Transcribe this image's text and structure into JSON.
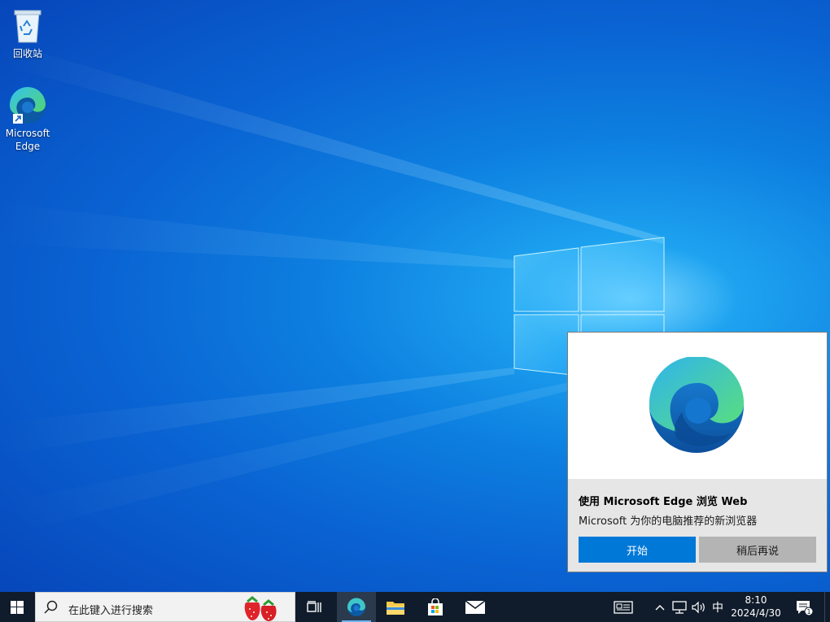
{
  "desktop": {
    "icons": [
      {
        "name": "recycle-bin",
        "label": "回收站"
      },
      {
        "name": "edge",
        "label": "Microsoft Edge"
      }
    ]
  },
  "toast": {
    "title": "使用 Microsoft Edge 浏览 Web",
    "body": "Microsoft 为你的电脑推荐的新浏览器",
    "primary_button": "开始",
    "secondary_button": "稍后再说"
  },
  "taskbar": {
    "search_placeholder": "在此键入进行搜索",
    "ime_indicator": "中",
    "time": "8:10",
    "date": "2024/4/30",
    "notification_count": "1",
    "accent_color": "#0078d7"
  }
}
